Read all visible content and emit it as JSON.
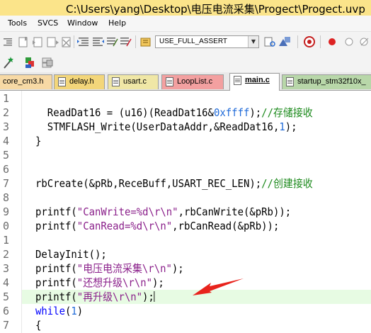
{
  "window": {
    "title": "C:\\Users\\yang\\Desktop\\电压电流采集\\Progect\\Progect.uvp"
  },
  "menu": {
    "items": [
      "Tools",
      "SVCS",
      "Window",
      "Help"
    ]
  },
  "toolbar": {
    "define_combo": {
      "value": "USE_FULL_ASSERT"
    }
  },
  "tabs": [
    {
      "label": "core_cm3.h",
      "color": "#f7d9a5",
      "active": false
    },
    {
      "label": "delay.h",
      "color": "#f3d67a",
      "active": false
    },
    {
      "label": "usart.c",
      "color": "#f0e7a6",
      "active": false
    },
    {
      "label": "LoopList.c",
      "color": "#f3a0a0",
      "active": false
    },
    {
      "label": "main.c",
      "color": "#ffffff",
      "active": true
    },
    {
      "label": "startup_stm32f10x_",
      "color": "#b8d7a9",
      "active": false
    }
  ],
  "editor": {
    "line_numbers": [
      "1",
      "2",
      "3",
      "4",
      "5",
      "6",
      "7",
      "8",
      "9",
      "0",
      "1",
      "2",
      "3",
      "4",
      "5",
      "6",
      "7"
    ],
    "highlighted_line_index": 14,
    "lines": [
      [],
      [
        {
          "t": "  ReadDat16 = (u16)(ReadDat16&",
          "c": "plain"
        },
        {
          "t": "0xffff",
          "c": "num"
        },
        {
          "t": ");",
          "c": "plain"
        },
        {
          "t": "//存储接收",
          "c": "cmt"
        }
      ],
      [
        {
          "t": "  STMFLASH_Write(UserDataAddr,&ReadDat16,",
          "c": "plain"
        },
        {
          "t": "1",
          "c": "num"
        },
        {
          "t": ");",
          "c": "plain"
        }
      ],
      [
        {
          "t": "}",
          "c": "plain"
        }
      ],
      [],
      [],
      [
        {
          "t": "rbCreate(&pRb,ReceBuff,USART_REC_LEN);",
          "c": "plain"
        },
        {
          "t": "//创建接收",
          "c": "cmt"
        }
      ],
      [],
      [
        {
          "t": "printf(",
          "c": "plain"
        },
        {
          "t": "\"CanWrite=%d\\r\\n\"",
          "c": "str"
        },
        {
          "t": ",rbCanWrite(&pRb));",
          "c": "plain"
        }
      ],
      [
        {
          "t": "printf(",
          "c": "plain"
        },
        {
          "t": "\"CanRead=%d\\r\\n\"",
          "c": "str"
        },
        {
          "t": ",rbCanRead(&pRb));",
          "c": "plain"
        }
      ],
      [],
      [
        {
          "t": "DelayInit();",
          "c": "plain"
        }
      ],
      [
        {
          "t": "printf(",
          "c": "plain"
        },
        {
          "t": "\"电压电流采集\\r\\n\"",
          "c": "str"
        },
        {
          "t": ");",
          "c": "plain"
        }
      ],
      [
        {
          "t": "printf(",
          "c": "plain"
        },
        {
          "t": "\"还想升级\\r\\n\"",
          "c": "str"
        },
        {
          "t": ");",
          "c": "plain"
        }
      ],
      [
        {
          "t": "printf(",
          "c": "plain"
        },
        {
          "t": "\"再升级\\r\\n\"",
          "c": "str"
        },
        {
          "t": ");",
          "c": "plain"
        },
        {
          "t": "",
          "c": "caret"
        }
      ],
      [
        {
          "t": "while",
          "c": "kw"
        },
        {
          "t": "(",
          "c": "plain"
        },
        {
          "t": "1",
          "c": "num"
        },
        {
          "t": ")",
          "c": "plain"
        }
      ],
      [
        {
          "t": "{",
          "c": "plain"
        }
      ]
    ]
  },
  "annotation": {
    "arrow_color": "#e8231c"
  },
  "colors": {
    "titlebar": "#fbe48a",
    "string": "#8a1f8a",
    "number": "#1f6ad8",
    "comment": "#1c8a1c",
    "keyword": "#0000ff",
    "current_line": "#e7fbe3"
  }
}
